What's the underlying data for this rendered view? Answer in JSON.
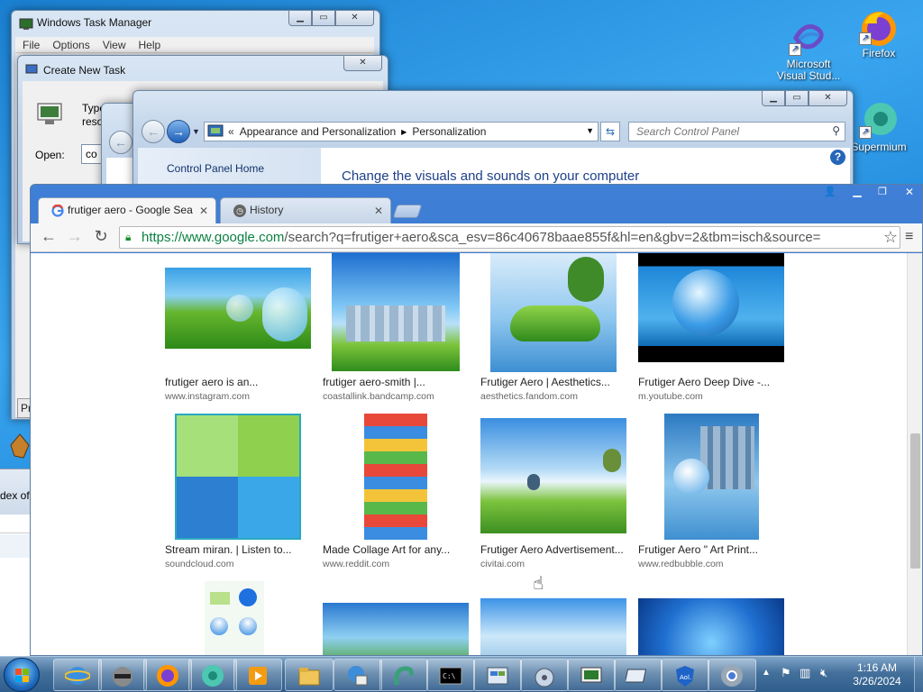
{
  "desktop": {
    "icons": [
      {
        "label": "Microsoft Visual Stud..."
      },
      {
        "label": "Firefox"
      },
      {
        "label": "Supermium"
      }
    ],
    "partial_text": "dex of"
  },
  "task_manager": {
    "title": "Windows Task Manager",
    "menu": [
      "File",
      "Options",
      "View",
      "Help"
    ],
    "partial_button": "Pr"
  },
  "create_task": {
    "title": "Create New Task",
    "desc_partial": "Type",
    "desc_partial2": "reso",
    "open_label": "Open:",
    "open_value": "co"
  },
  "control_panel": {
    "breadcrumb": [
      "«",
      "Appearance and Personalization",
      "Personalization"
    ],
    "search_placeholder": "Search Control Panel",
    "home_link": "Control Panel Home",
    "heading": "Change the visuals and sounds on your computer"
  },
  "browser": {
    "tabs": [
      {
        "label": "frutiger aero - Google Sea",
        "active": true
      },
      {
        "label": "History",
        "active": false
      }
    ],
    "url_host": "https://www.google.com",
    "url_path": "/search?q=frutiger+aero&sca_esv=86c40678baae855f&hl=en&gbv=2&tbm=isch&source=",
    "results": [
      {
        "title": "frutiger aero is an...",
        "site": "www.instagram.com"
      },
      {
        "title": "frutiger aero-smith |...",
        "site": "coastallink.bandcamp.com"
      },
      {
        "title": "Frutiger Aero | Aesthetics...",
        "site": "aesthetics.fandom.com"
      },
      {
        "title": "Frutiger Aero Deep Dive -...",
        "site": "m.youtube.com"
      },
      {
        "title": "Stream miran. | Listen to...",
        "site": "soundcloud.com"
      },
      {
        "title": "Made Collage Art for any...",
        "site": "www.reddit.com"
      },
      {
        "title": "Frutiger Aero Advertisement...",
        "site": "civitai.com"
      },
      {
        "title": "Frutiger Aero \" Art Print...",
        "site": "www.redbubble.com"
      }
    ]
  },
  "taskbar": {
    "apps": [
      "start-orb",
      "internet-explorer",
      "raccoon-app",
      "firefox",
      "supermium",
      "media-player",
      "file-explorer",
      "system-app",
      "snake-app",
      "command-prompt",
      "control-panel-app",
      "media-center",
      "task-manager-app",
      "run-dialog-app",
      "defender",
      "chrome"
    ],
    "clock_time": "1:16 AM",
    "clock_date": "3/26/2024"
  },
  "colors": {
    "accent": "#1a73e8",
    "title_blue": "#1e3f8a",
    "link": "#1e5eb0"
  }
}
